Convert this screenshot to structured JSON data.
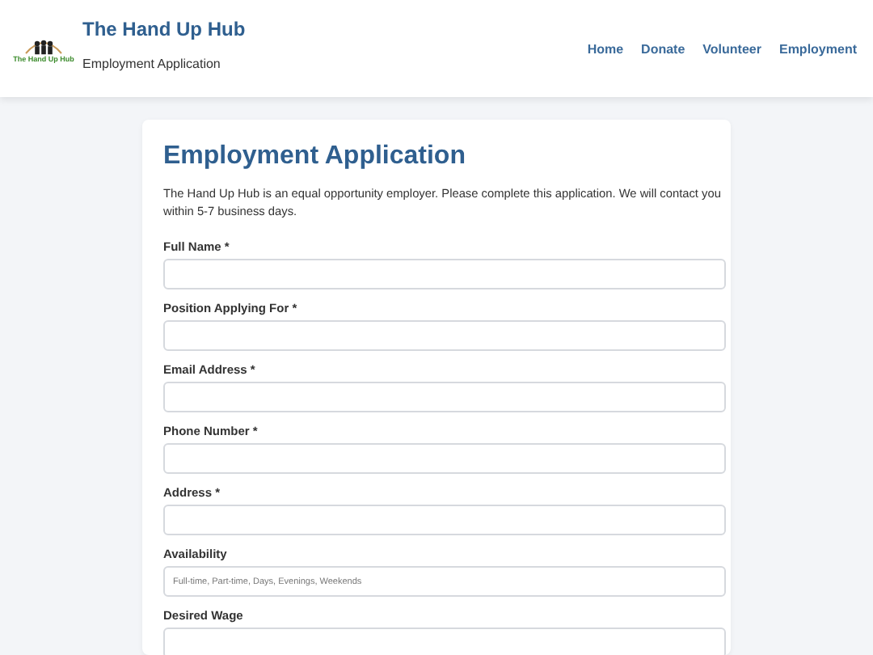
{
  "header": {
    "logo_text": "The Hand Up Hub",
    "site_title": "The Hand Up Hub",
    "subtitle": "Employment Application",
    "nav": [
      {
        "label": "Home"
      },
      {
        "label": "Donate"
      },
      {
        "label": "Volunteer"
      },
      {
        "label": "Employment"
      }
    ]
  },
  "form": {
    "title": "Employment Application",
    "intro": "The Hand Up Hub is an equal opportunity employer. Please complete this application. We will contact you within 5-7 business days.",
    "fields": [
      {
        "label": "Full Name *"
      },
      {
        "label": "Position Applying For *"
      },
      {
        "label": "Email Address *"
      },
      {
        "label": "Phone Number *"
      },
      {
        "label": "Address *"
      },
      {
        "label": "Availability",
        "placeholder": "Full-time, Part-time, Days, Evenings, Weekends"
      },
      {
        "label": "Desired Wage"
      }
    ]
  }
}
